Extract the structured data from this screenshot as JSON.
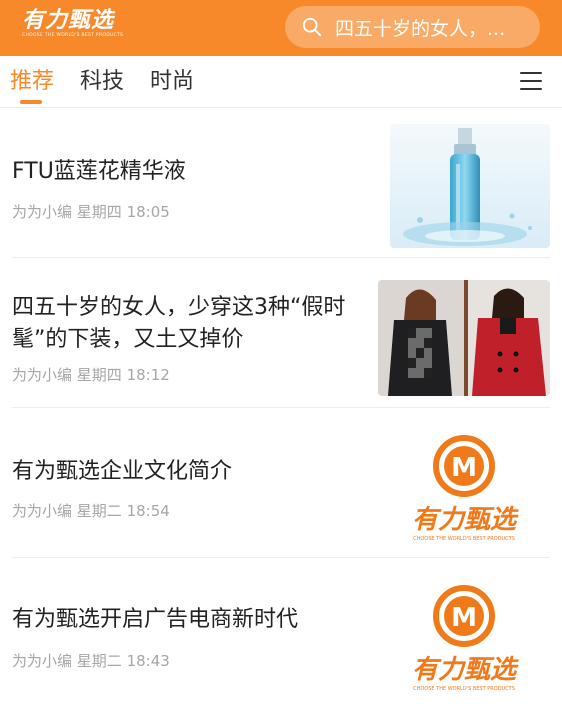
{
  "header": {
    "logo_text": "有力甄选",
    "logo_tagline": "CHOOSE THE WORLD'S BEST PRODUCTS",
    "search_placeholder": "四五十岁的女人，...",
    "brand_color": "#f7892b"
  },
  "tabs": [
    {
      "label": "推荐",
      "active": true
    },
    {
      "label": "科技",
      "active": false
    },
    {
      "label": "时尚",
      "active": false
    }
  ],
  "menu_icon": "hamburger-menu-icon",
  "articles": [
    {
      "title": "FTU蓝莲花精华液",
      "author": "为为小编",
      "time": "星期四 18:05",
      "thumb": "serum-bottle-photo"
    },
    {
      "title": "四五十岁的女人，少穿这3种“假时髦”的下装，又土又掉价",
      "author": "为为小编",
      "time": "星期四 18:12",
      "thumb": "coat-fashion-photo"
    },
    {
      "title": "有为甄选企业文化简介",
      "author": "为为小编",
      "time": "星期二 18:54",
      "thumb": "brand-logo"
    },
    {
      "title": "有为甄选开启广告电商新时代",
      "author": "为为小编",
      "time": "星期二 18:43",
      "thumb": "brand-logo"
    }
  ],
  "brand_logo": {
    "letter": "M",
    "text": "有力甄选",
    "tagline": "CHOOSE THE WORLD'S BEST PRODUCTS"
  }
}
